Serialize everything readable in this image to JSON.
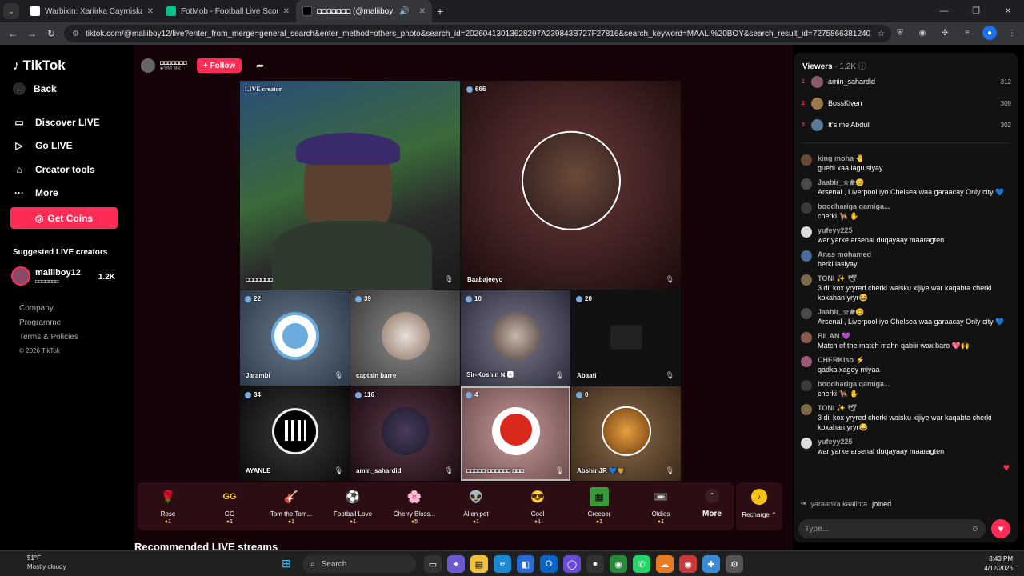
{
  "browser": {
    "tabs": [
      {
        "title": "Warbixin: Xariirka Caymiska ee",
        "icon": "document-icon",
        "color": "#ffffff"
      },
      {
        "title": "FotMob - Football Live Scores",
        "icon": "fotmob-icon",
        "color": "#00c48c"
      },
      {
        "title": "◘◘◘◘◘◘◘ (@maliiboy1",
        "icon": "tiktok-icon",
        "color": "#000000"
      }
    ],
    "url": "tiktok.com/@maliiboy12/live?enter_from_merge=general_search&enter_method=others_photo&search_id=20260413013628297A239843B727F27816&search_keyword=MAALI%20BOY&search_result_id=7275866381240248388&search_t..."
  },
  "sidebar": {
    "logo": "TikTok",
    "back": "Back",
    "menu": [
      {
        "label": "Discover LIVE",
        "icon": "tv-icon"
      },
      {
        "label": "Go LIVE",
        "icon": "camera-icon"
      },
      {
        "label": "Creator tools",
        "icon": "lightbulb-icon"
      },
      {
        "label": "More",
        "icon": "ellipsis-icon"
      }
    ],
    "get_coins": "Get Coins",
    "suggested_title": "Suggested LIVE creators",
    "suggested": {
      "name": "maliiboy12",
      "sub": "◘◘◘◘◘◘◘",
      "count": "1.2K"
    },
    "links": [
      "Company",
      "Programme",
      "Terms & Policies"
    ],
    "copyright": "© 2026 TikTok"
  },
  "host": {
    "name": "◘◘◘◘◘◘◘",
    "likes": "♥191.9K",
    "follow": "+ Follow"
  },
  "cells": [
    {
      "badge": "LIVE creator",
      "name": "◘◘◘◘◘◘◘"
    },
    {
      "badge": "666",
      "name": "Baabajeeyo"
    },
    {
      "badge": "22",
      "name": "Jarambi"
    },
    {
      "badge": "39",
      "name": "captain barre"
    },
    {
      "badge": "10",
      "name": "Sir-Koshin ⛕ 🅰"
    },
    {
      "badge": "20",
      "name": "Abaati"
    },
    {
      "badge": "34",
      "name": "AYANLE"
    },
    {
      "badge": "116",
      "name": "amin_sahardid"
    },
    {
      "badge": "4",
      "name": "◘◘◘◘◘ ◘◘◘◘◘◘ ◘◘◘"
    },
    {
      "badge": "0",
      "name": "Abshir JR 💙🦁"
    }
  ],
  "gifts": [
    {
      "name": "Rose",
      "price": "1",
      "icon": "🌹",
      "color": "#3a0a12"
    },
    {
      "name": "GG",
      "price": "1",
      "icon": "GG",
      "color": "#2a2a10"
    },
    {
      "name": "Tom the Tom...",
      "price": "1",
      "icon": "🎸",
      "color": "#2a1010"
    },
    {
      "name": "Football Love",
      "price": "1",
      "icon": "⚽",
      "color": "#2a1020"
    },
    {
      "name": "Cherry Bloss...",
      "price": "5",
      "icon": "🌸",
      "color": "#2a1020"
    },
    {
      "name": "Alien pet",
      "price": "1",
      "icon": "👽",
      "color": "#2a1030"
    },
    {
      "name": "Cool",
      "price": "1",
      "icon": "😎",
      "color": "#2a2010"
    },
    {
      "name": "Creeper",
      "price": "1",
      "icon": "▦",
      "color": "#103010"
    },
    {
      "name": "Oldies",
      "price": "1",
      "icon": "📼",
      "color": "#201030"
    }
  ],
  "more": "More",
  "recharge": "Recharge ⌃",
  "recommended": "Recommended LIVE streams",
  "viewers": {
    "title": "Viewers",
    "count": "· 1.2K",
    "top": [
      {
        "rank": "1",
        "name": "amin_sahardid",
        "score": "312"
      },
      {
        "rank": "2",
        "name": "BossKiven",
        "score": "309"
      },
      {
        "rank": "3",
        "name": "It's me Abdull",
        "score": "302"
      }
    ]
  },
  "chat": [
    {
      "user": "king moha 🤚",
      "text": "guehi xaa lagu siyay"
    },
    {
      "user": "Jaabir_☆❀😊",
      "text": "Arsenal , Liverpool iyo Chelsea waa garaacay Only city 💙"
    },
    {
      "user": "boodhariga qamiga...",
      "text": "cherki 🐕‍🦺 ✋"
    },
    {
      "user": "yufeyy225",
      "text": "war yarke arsenal duqayaay maaragten"
    },
    {
      "user": "Anas mohamed",
      "text": "herki lasiyay"
    },
    {
      "user": "TONI ✨ 🕊",
      "text": "3 dii kox yryred cherki waisku xijiye war kaqabta cherki koxahan yryr😂"
    },
    {
      "user": "Jaabir_☆❀😊",
      "text": "Arsenal , Liverpool iyo Chelsea waa garaacay Only city 💙"
    },
    {
      "user": "BILAN 💜",
      "text": "Match of the match mahn qabiir wax baro 💖🙌"
    },
    {
      "user": "CHERKIso ⚡",
      "text": "qadka xagey miyaa"
    },
    {
      "user": "boodhariga qamiga...",
      "text": "cherki 🐕‍🦺 ✋"
    },
    {
      "user": "TONI ✨ 🕊",
      "text": "3 dii kox yryred cherki waisku xijiye war kaqabta cherki koxahan yryr😂"
    },
    {
      "user": "yufeyy225",
      "text": "war yarke arsenal duqayaay maaragten"
    }
  ],
  "joined": {
    "user": "yaraanka kaalinta",
    "text": "joined"
  },
  "input_placeholder": "Type...",
  "taskbar": {
    "temp": "51°F",
    "weather": "Mostly cloudy",
    "search": "Search",
    "time": "8:43 PM",
    "date": "4/12/2026"
  }
}
